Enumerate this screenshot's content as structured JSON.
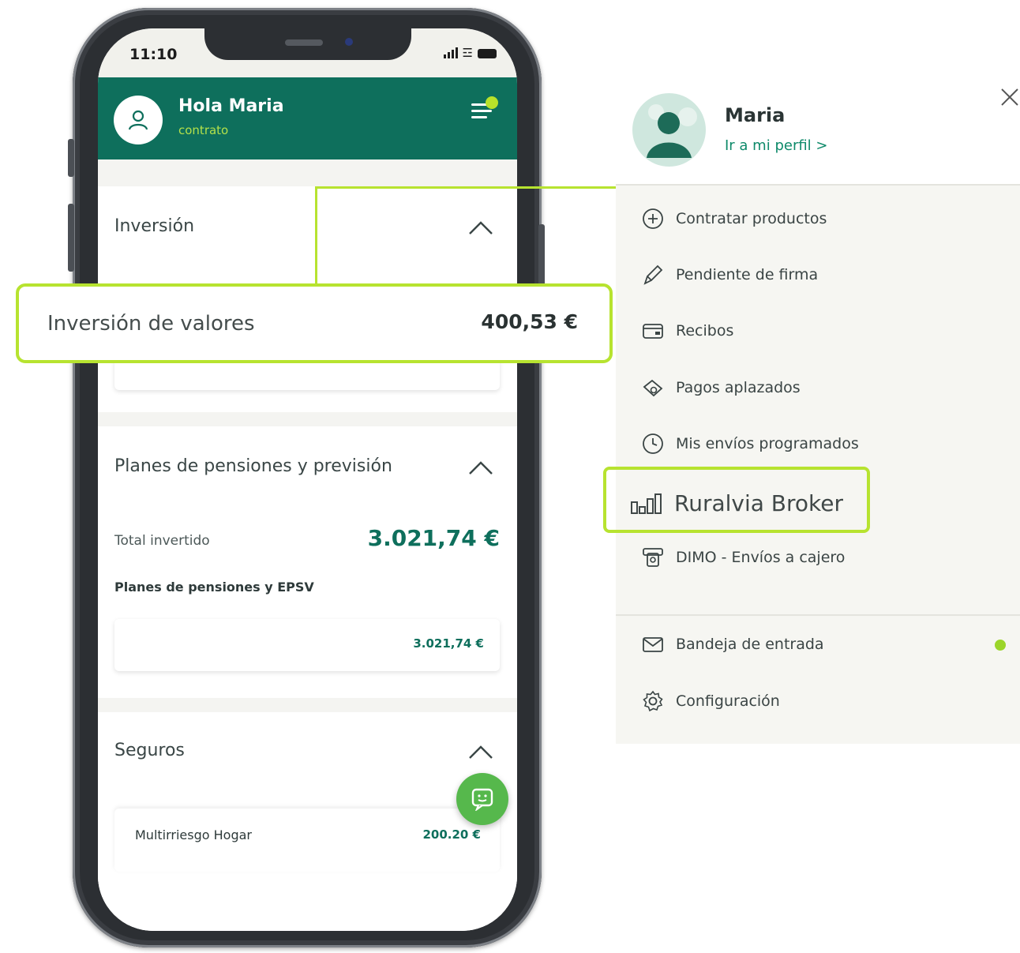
{
  "status_bar": {
    "time": "11:10"
  },
  "header": {
    "greeting": "Hola Maria",
    "subtitle": "contrato"
  },
  "sections": {
    "investment": {
      "title": "Inversión"
    },
    "pensions": {
      "title": "Planes de pensiones y previsión",
      "total_label": "Total invertido",
      "total_value": "3.021,74 €",
      "subheading": "Planes de pensiones y EPSV",
      "card_value": "3.021,74 €"
    },
    "insurance": {
      "title": "Seguros",
      "item_label": "Multirriesgo Hogar",
      "item_value": "200.20 €"
    }
  },
  "callout": {
    "label": "Inversión de valores",
    "value": "400,53 €"
  },
  "side_menu": {
    "profile_name": "Maria",
    "profile_link": "Ir a mi perfil >",
    "items": [
      {
        "label": "Contratar productos",
        "icon": "plus-circle-icon"
      },
      {
        "label": "Pendiente de firma",
        "icon": "pen-icon"
      },
      {
        "label": "Recibos",
        "icon": "receipt-icon"
      },
      {
        "label": "Pagos aplazados",
        "icon": "deferred-payment-icon"
      },
      {
        "label": "Mis envíos programados",
        "icon": "clock-icon"
      },
      {
        "label": "Ruralvia Broker",
        "icon": "bar-chart-icon"
      },
      {
        "label": "DIMO - Envíos a cajero",
        "icon": "atm-icon"
      }
    ],
    "bottom_items": [
      {
        "label": "Bandeja de entrada",
        "icon": "envelope-icon"
      },
      {
        "label": "Configuración",
        "icon": "gear-icon"
      }
    ]
  },
  "colors": {
    "brand_green": "#0e6f5c",
    "accent_lime": "#b7e330",
    "fab_green": "#56b84c"
  }
}
